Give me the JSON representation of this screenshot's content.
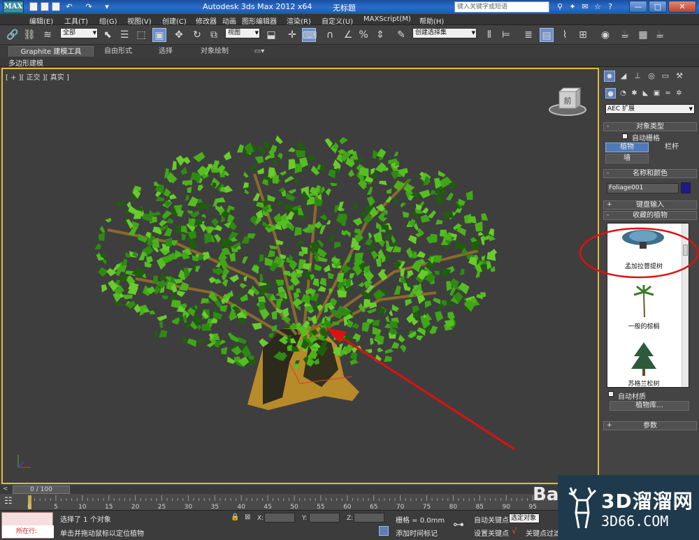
{
  "titlebar": {
    "app_name": "Autodesk 3ds Max  2012 x64",
    "file_name": "无标题",
    "search_placeholder": "键入关键字或短语",
    "logo_text": "MAX",
    "minimize": "—",
    "maximize": "□",
    "close": "✕"
  },
  "menu": {
    "items": [
      "编辑(E)",
      "工具(T)",
      "组(G)",
      "视图(V)",
      "创建(C)",
      "修改器",
      "动画",
      "图形编辑器",
      "渲染(R)",
      "自定义(U)",
      "MAXScript(M)",
      "帮助(H)"
    ]
  },
  "toolbar": {
    "selection_filter": "全部",
    "ref_coord": "视图",
    "named_selection": "创建选择集"
  },
  "ribbon": {
    "tabs": [
      "Graphite 建模工具",
      "自由形式",
      "选择",
      "对象绘制"
    ],
    "sub_label": "多边形建模"
  },
  "viewport": {
    "label": "[ + ][ 正交 ][ 真实 ]",
    "viewcube_face": "前"
  },
  "command_panel": {
    "category": "AEC 扩展",
    "rollout_object_type": "对象类型",
    "auto_grid": "自动栅格",
    "btn_foliage": "植物",
    "btn_railing": "栏杆",
    "btn_wall": "墙",
    "rollout_name_color": "名称和颜色",
    "object_name": "Foliage001",
    "rollout_keyboard": "键盘输入",
    "rollout_favorites": "收藏的植物",
    "plants": [
      "孟加拉菩提树",
      "一般的棕榈",
      "苏格兰松树"
    ],
    "auto_material": "自动材质",
    "plant_library": "植物库...",
    "rollout_params": "参数",
    "plus": "+",
    "minus": "-",
    "swatch_color": "#1b1b8c"
  },
  "timeline": {
    "frame_display": "0 / 100",
    "ticks": [
      "0",
      "5",
      "10",
      "15",
      "20",
      "25",
      "30",
      "35",
      "40",
      "45",
      "50",
      "55",
      "60",
      "65",
      "70",
      "75",
      "80",
      "85",
      "90",
      "95"
    ]
  },
  "status": {
    "listener": "所在行:",
    "selected": "选择了 1 个对象",
    "prompt": "单击并拖动鼠标以定位植物",
    "x_label": "X:",
    "y_label": "Y:",
    "z_label": "Z:",
    "grid": "栅格 = 0.0mm",
    "add_time_tag": "添加时间标记",
    "auto_key": "自动关键点",
    "set_key": "设置关键点",
    "selected_obj": "选定对象",
    "key_filter": "关键点过滤"
  },
  "watermark": {
    "ba": "Ba",
    "name": "3D溜溜网",
    "url": "3D66.COM"
  },
  "colors": {
    "viewport_border": "#e2bb3a",
    "annotation_red": "#e01010",
    "leaf_green": "#3fa617",
    "trunk": "#b78a2a"
  }
}
